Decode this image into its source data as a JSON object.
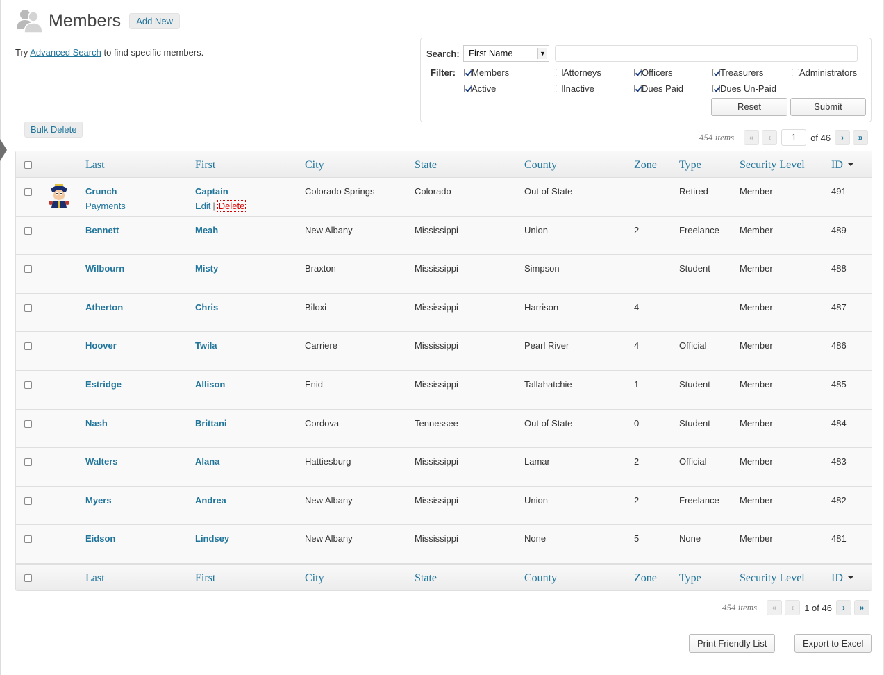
{
  "header": {
    "title": "Members",
    "add_new": "Add New"
  },
  "intro": {
    "prefix": "Try",
    "link": "Advanced Search",
    "suffix": "to find specific members."
  },
  "bulk_delete": "Bulk Delete",
  "search": {
    "label": "Search:",
    "field_selected": "First Name",
    "query": "",
    "filter_label": "Filter:",
    "filters": [
      {
        "label": "Members",
        "checked": true
      },
      {
        "label": "Attorneys",
        "checked": false
      },
      {
        "label": "Officers",
        "checked": true
      },
      {
        "label": "Treasurers",
        "checked": true
      },
      {
        "label": "Administrators",
        "checked": false
      },
      {
        "label": "Active",
        "checked": true
      },
      {
        "label": "Inactive",
        "checked": false
      },
      {
        "label": "Dues Paid",
        "checked": true
      },
      {
        "label": "Dues Un-Paid",
        "checked": true
      }
    ],
    "reset": "Reset",
    "submit": "Submit"
  },
  "pager_top": {
    "items": "454 items",
    "first": "«",
    "prev": "‹",
    "page": "1",
    "of": "of 46",
    "next": "›",
    "last": "»"
  },
  "pager_bottom": {
    "items": "454 items",
    "first": "«",
    "prev": "‹",
    "page_text": "1 of 46",
    "next": "›",
    "last": "»"
  },
  "columns": [
    "Last",
    "First",
    "City",
    "State",
    "County",
    "Zone",
    "Type",
    "Security Level",
    "ID"
  ],
  "row_actions": {
    "payments": "Payments",
    "edit": "Edit",
    "sep": "|",
    "delete": "Delete"
  },
  "rows": [
    {
      "last": "Crunch",
      "first": "Captain",
      "city": "Colorado Springs",
      "state": "Colorado",
      "county": "Out of State",
      "zone": "",
      "type": "Retired",
      "security": "Member",
      "id": "491"
    },
    {
      "last": "Bennett",
      "first": "Meah",
      "city": "New Albany",
      "state": "Mississippi",
      "county": "Union",
      "zone": "2",
      "type": "Freelance",
      "security": "Member",
      "id": "489"
    },
    {
      "last": "Wilbourn",
      "first": "Misty",
      "city": "Braxton",
      "state": "Mississippi",
      "county": "Simpson",
      "zone": "",
      "type": "Student",
      "security": "Member",
      "id": "488"
    },
    {
      "last": "Atherton",
      "first": "Chris",
      "city": "Biloxi",
      "state": "Mississippi",
      "county": "Harrison",
      "zone": "4",
      "type": "",
      "security": "Member",
      "id": "487"
    },
    {
      "last": "Hoover",
      "first": "Twila",
      "city": "Carriere",
      "state": "Mississippi",
      "county": "Pearl River",
      "zone": "4",
      "type": "Official",
      "security": "Member",
      "id": "486"
    },
    {
      "last": "Estridge",
      "first": "Allison",
      "city": "Enid",
      "state": "Mississippi",
      "county": "Tallahatchie",
      "zone": "1",
      "type": "Student",
      "security": "Member",
      "id": "485"
    },
    {
      "last": "Nash",
      "first": "Brittani",
      "city": "Cordova",
      "state": "Tennessee",
      "county": "Out of State",
      "zone": "0",
      "type": "Student",
      "security": "Member",
      "id": "484"
    },
    {
      "last": "Walters",
      "first": "Alana",
      "city": "Hattiesburg",
      "state": "Mississippi",
      "county": "Lamar",
      "zone": "2",
      "type": "Official",
      "security": "Member",
      "id": "483"
    },
    {
      "last": "Myers",
      "first": "Andrea",
      "city": "New Albany",
      "state": "Mississippi",
      "county": "Union",
      "zone": "2",
      "type": "Freelance",
      "security": "Member",
      "id": "482"
    },
    {
      "last": "Eidson",
      "first": "Lindsey",
      "city": "New Albany",
      "state": "Mississippi",
      "county": "None",
      "zone": "5",
      "type": "None",
      "security": "Member",
      "id": "481"
    }
  ],
  "footer_buttons": {
    "print": "Print Friendly List",
    "export": "Export to Excel"
  },
  "colors": {
    "link": "#21759b",
    "delete": "#dd0000"
  }
}
